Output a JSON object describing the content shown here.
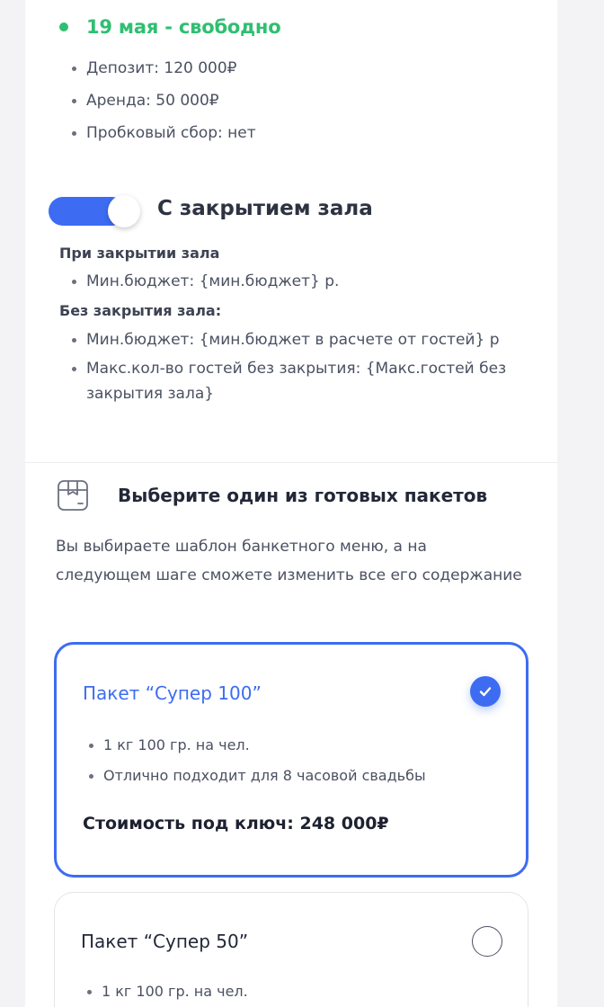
{
  "availability": {
    "date_status": "19 мая - свободно",
    "status_color": "#2fbf71"
  },
  "details": [
    "Депозит: 120 000₽",
    "Аренда: 50 000₽",
    "Пробковый сбор: нет"
  ],
  "hall_closure": {
    "toggle_on": true,
    "toggle_label": "С закрытием зала",
    "with_closure_title": "При закрытии зала",
    "with_closure_items": [
      "Мин.бюджет: {мин.бюджет} р."
    ],
    "without_closure_title": "Без закрытия зала:",
    "without_closure_items": [
      "Мин.бюджет: {мин.бюджет в расчете от гостей} р",
      "Макс.кол-во гостей без закрытия: {Макс.гостей без закрытия зала}"
    ]
  },
  "packages": {
    "icon": "box-icon",
    "title": "Выберите один из готовых пакетов",
    "description": "Вы выбираете шаблон банкетного меню, а на следующем шаге сможете изменить все его содержание",
    "items": [
      {
        "name": "Пакет “Супер 100”",
        "selected": true,
        "features": [
          "1 кг 100 гр. на чел.",
          "Отлично подходит для 8 часовой свадьбы"
        ],
        "price": "Стоимость под ключ: 248 000₽"
      },
      {
        "name": "Пакет “Супер 50”",
        "selected": false,
        "features": [
          "1 кг 100 гр. на чел."
        ]
      }
    ]
  },
  "colors": {
    "accent": "#3d6cf2",
    "success": "#2fbf71",
    "text": "#3d4352"
  }
}
